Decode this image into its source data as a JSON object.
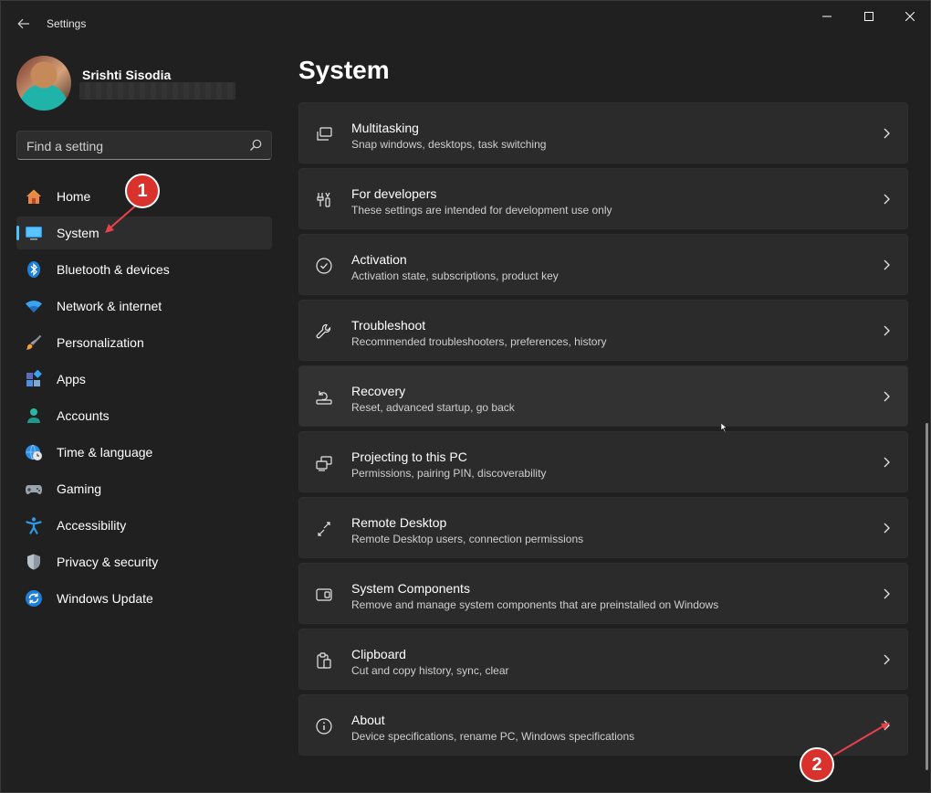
{
  "window": {
    "title": "Settings",
    "controls": {
      "minimize": "minimize-icon",
      "maximize": "maximize-icon",
      "close": "close-icon"
    }
  },
  "profile": {
    "name": "Srishti Sisodia"
  },
  "search": {
    "placeholder": "Find a setting"
  },
  "sidebar": {
    "items": [
      {
        "label": "Home",
        "icon": "home-icon"
      },
      {
        "label": "System",
        "icon": "monitor-icon",
        "active": true
      },
      {
        "label": "Bluetooth & devices",
        "icon": "bluetooth-icon"
      },
      {
        "label": "Network & internet",
        "icon": "wifi-icon"
      },
      {
        "label": "Personalization",
        "icon": "brush-icon"
      },
      {
        "label": "Apps",
        "icon": "apps-icon"
      },
      {
        "label": "Accounts",
        "icon": "person-icon"
      },
      {
        "label": "Time & language",
        "icon": "globe-clock-icon"
      },
      {
        "label": "Gaming",
        "icon": "gamepad-icon"
      },
      {
        "label": "Accessibility",
        "icon": "accessibility-icon"
      },
      {
        "label": "Privacy & security",
        "icon": "shield-icon"
      },
      {
        "label": "Windows Update",
        "icon": "update-icon"
      }
    ]
  },
  "main": {
    "title": "System",
    "cards": [
      {
        "title": "Multitasking",
        "subtitle": "Snap windows, desktops, task switching",
        "icon": "multitasking-icon"
      },
      {
        "title": "For developers",
        "subtitle": "These settings are intended for development use only",
        "icon": "developer-tools-icon"
      },
      {
        "title": "Activation",
        "subtitle": "Activation state, subscriptions, product key",
        "icon": "checkmark-circle-icon"
      },
      {
        "title": "Troubleshoot",
        "subtitle": "Recommended troubleshooters, preferences, history",
        "icon": "wrench-icon"
      },
      {
        "title": "Recovery",
        "subtitle": "Reset, advanced startup, go back",
        "icon": "recovery-icon"
      },
      {
        "title": "Projecting to this PC",
        "subtitle": "Permissions, pairing PIN, discoverability",
        "icon": "projecting-icon"
      },
      {
        "title": "Remote Desktop",
        "subtitle": "Remote Desktop users, connection permissions",
        "icon": "remote-desktop-icon"
      },
      {
        "title": "System Components",
        "subtitle": "Remove and manage system components that are preinstalled on Windows",
        "icon": "system-components-icon"
      },
      {
        "title": "Clipboard",
        "subtitle": "Cut and copy history, sync, clear",
        "icon": "clipboard-icon"
      },
      {
        "title": "About",
        "subtitle": "Device specifications, rename PC, Windows specifications",
        "icon": "info-icon"
      }
    ]
  },
  "annotations": [
    {
      "label": "1",
      "color": "#d9312b"
    },
    {
      "label": "2",
      "color": "#d9312b"
    }
  ],
  "colors": {
    "accent": "#4cc2ff",
    "background": "#202020",
    "card": "#2b2b2b"
  }
}
